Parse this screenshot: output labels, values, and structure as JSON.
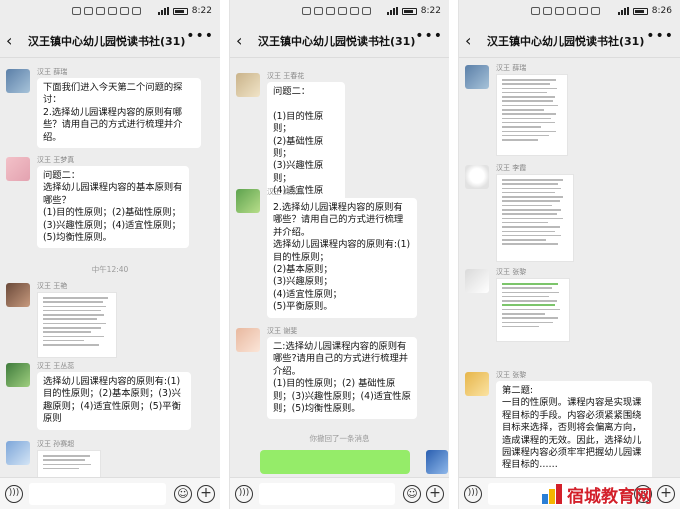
{
  "status": {
    "time_left": "8:22",
    "time_middle": "8:22",
    "time_right": "8:26"
  },
  "chat_title": "汉王镇中心幼儿园悦读书社(31)",
  "common": {
    "back_icon": "chevron-left-icon",
    "more_icon": "more-dots-icon",
    "voice_icon": "voice-icon",
    "emoji_icon": "emoji-icon",
    "plus_icon": "plus-icon",
    "recall_text": "你撤回了一条消息",
    "time_divider": "中午12:40"
  },
  "phone1": {
    "m1": {
      "name": "汉王 薛瑞",
      "text": "下面我们进入今天第二个问题的探讨：\n2.选择幼儿园课程内容的原则有哪些？请用自己的方式进行梳理并介绍。"
    },
    "m2": {
      "name": "汉王 王梦真",
      "text": "问题二：\n选择幼儿园课程内容的基本原则有哪些？\n(1)目的性原则；(2)基础性原则；(3)兴趣性原则；(4)适宜性原则；(5)均衡性原则。"
    },
    "m3": {
      "name": "汉王 王艳"
    },
    "m4": {
      "name": "汉王 王丛蕊",
      "text": "选择幼儿园课程内容的原则有:(1)目的性原则；(2)基本原则；(3)兴趣原则；(4)适宜性原则；(5)平衡原则"
    },
    "m5": {
      "name": "汉王 孙赛超"
    }
  },
  "phone2": {
    "m1": {
      "name": "汉王 王春花",
      "text": "问题二：\n\n(1)目的性原则；\n(2)基础性原则；\n(3)兴趣性原则；\n(4)适宜性原则；\n(5)均衡性原则。"
    },
    "m2": {
      "name": "汉王 韩双燕",
      "text": "2.选择幼儿园课程内容的原则有哪些？请用自己的方式进行梳理并介绍。\n选择幼儿园课程内容的原则有:(1)目的性原则；\n(2)基本原则；\n(3)兴趣原则；\n(4)适宜性原则；\n(5)平衡原则。"
    },
    "m3": {
      "name": "汉王 谢斐",
      "text": "二:选择幼儿园课程内容的原则有哪些?请用自己的方式进行梳理并介绍。\n(1)目的性原则；(2) 基础性原则；(3)兴趣性原则；(4)适宜性原则；(5)均衡性原则。"
    }
  },
  "phone3": {
    "m1": {
      "name": "汉王 薛瑞"
    },
    "m2": {
      "name": "汉王 李霞"
    },
    "m3": {
      "name": "汉王 张黎"
    },
    "m4": {
      "name": "汉王 张黎",
      "text": "第二题:\n一目的性原则。课程内容是实现课程目标的手段。内容必须紧紧围绕目标来选择，否则将会偏离方向，造成课程的无效。因此，选择幼儿园课程内容必须牢牢把握幼儿园课程目标的……"
    }
  },
  "watermark": {
    "text": "宿城教育网"
  },
  "colors": {
    "bubble": "#ffffff",
    "background": "#ededed",
    "sent_bubble": "#95ec69",
    "watermark": "#d3202a"
  }
}
